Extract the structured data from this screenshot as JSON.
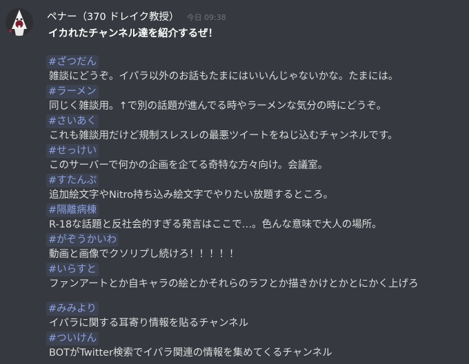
{
  "message": {
    "author": "ペナー（370 ドレイク教授）",
    "timestamp": "今日 09:38",
    "headline": "イカれたチャンネル達を紹介するぜ！",
    "channels": [
      {
        "name": "#ざつだん",
        "description": "雑談にどうぞ。イパラ以外のお話もたまにはいいんじゃないかな。たまには。"
      },
      {
        "name": "#ラーメン",
        "description": "同じく雑談用。↑で別の話題が進んでる時やラーメンな気分の時にどうぞ。"
      },
      {
        "name": "#さいあく",
        "description": "これも雑談用だけど規制スレスレの最悪ツイートをねじ込むチャンネルです。"
      },
      {
        "name": "#せっけい",
        "description": "このサーバーで何かの企画を企てる奇特な方々向け。会議室。"
      },
      {
        "name": "#すたんぷ",
        "description": "追加絵文字やNitro持ち込み絵文字でやりたい放題するところ。"
      },
      {
        "name": "#隔離病棟",
        "description": "R-18な話題と反社会的すぎる発言はここで…。色んな意味で大人の場所。"
      },
      {
        "name": "#がぞうかいわ",
        "description": "動画と画像でクソリプし続けろ！！！！！"
      },
      {
        "name": "#いらすと",
        "description": "ファンアートとか自キャラの絵とかそれらのラフとか描きかけとかとにかく上げろ"
      },
      {
        "name": "#みみより",
        "description": "イパラに関する耳寄り情報を貼るチャンネル"
      },
      {
        "name": "#ついけん",
        "description": "BOTがTwitter検索でイパラ関連の情報を集めてくるチャンネル"
      }
    ]
  },
  "colors": {
    "background": "#36393f",
    "mention_text": "#8ea1e1",
    "mention_bg": "rgba(114,137,218,0.12)",
    "username": "#ffffff",
    "timestamp": "#72767d",
    "body_text": "#dcddde"
  },
  "icons": {
    "avatar": "avatar"
  }
}
